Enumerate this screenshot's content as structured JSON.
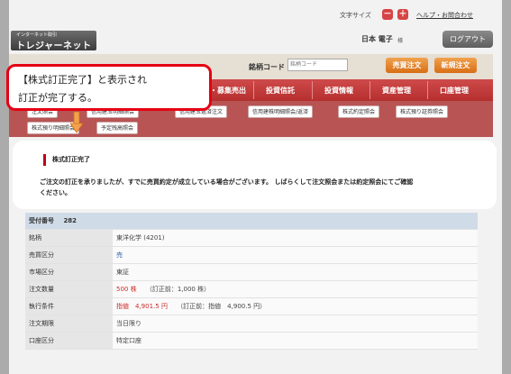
{
  "header": {
    "font_size_label": "文字サイズ",
    "font_decrease": "－",
    "font_increase": "＋",
    "help_link": "ヘルプ・お問合わせ",
    "logo_small": "インターネット取引",
    "logo_main": "トレジャーネット",
    "user_name": "日本 電子",
    "user_suffix": "様",
    "logout": "ログアウト"
  },
  "search": {
    "code_label": "銘柄コード",
    "code_placeholder": "銘柄コード",
    "buy_sell_button": "売買注文",
    "new_order_button": "新規注文"
  },
  "nav": {
    "items": [
      "・募集売出",
      "投資信託",
      "投資情報",
      "資産管理",
      "口座管理"
    ]
  },
  "subnav": {
    "row1": [
      "注文照会",
      "信用建玉明細照会",
      "信用建玉返済注文",
      "信用建株明細照会/返済",
      "株式約定照会",
      "株式預り証券照会"
    ],
    "row2": [
      "株式預り明細照会",
      "予定残高照会"
    ]
  },
  "callout": {
    "line1": "【株式訂正完了】と表示され",
    "line2": "訂正が完了する。"
  },
  "message": {
    "title": "株式訂正完了",
    "line1": "ご注文の訂正を承りましたが、すでに売買約定が成立している場合がございます。 しばらくして注文照会または約定照会にてご確認",
    "line2": "ください。"
  },
  "order": {
    "receipt_label": "受付番号",
    "receipt_no": "282",
    "rows": {
      "stock": {
        "label": "銘柄",
        "value": "東洋化学 (4201)"
      },
      "side": {
        "label": "売買区分",
        "value": "売"
      },
      "market": {
        "label": "市場区分",
        "value": "東証"
      },
      "quantity": {
        "label": "注文数量",
        "value": "500 株",
        "note": "（訂正前：1,000 株）"
      },
      "condition": {
        "label": "執行条件",
        "value": "指値　4,901.5 円",
        "note": "（訂正前：指値　4,900.5 円）"
      },
      "period": {
        "label": "注文期限",
        "value": "当日限り"
      },
      "account": {
        "label": "口座区分",
        "value": "特定口座"
      }
    }
  },
  "colors": {
    "accent_red": "#c0001c",
    "nav_red": "#b52f2f",
    "orange_button": "#e07f24",
    "link_blue": "#3366aa"
  }
}
